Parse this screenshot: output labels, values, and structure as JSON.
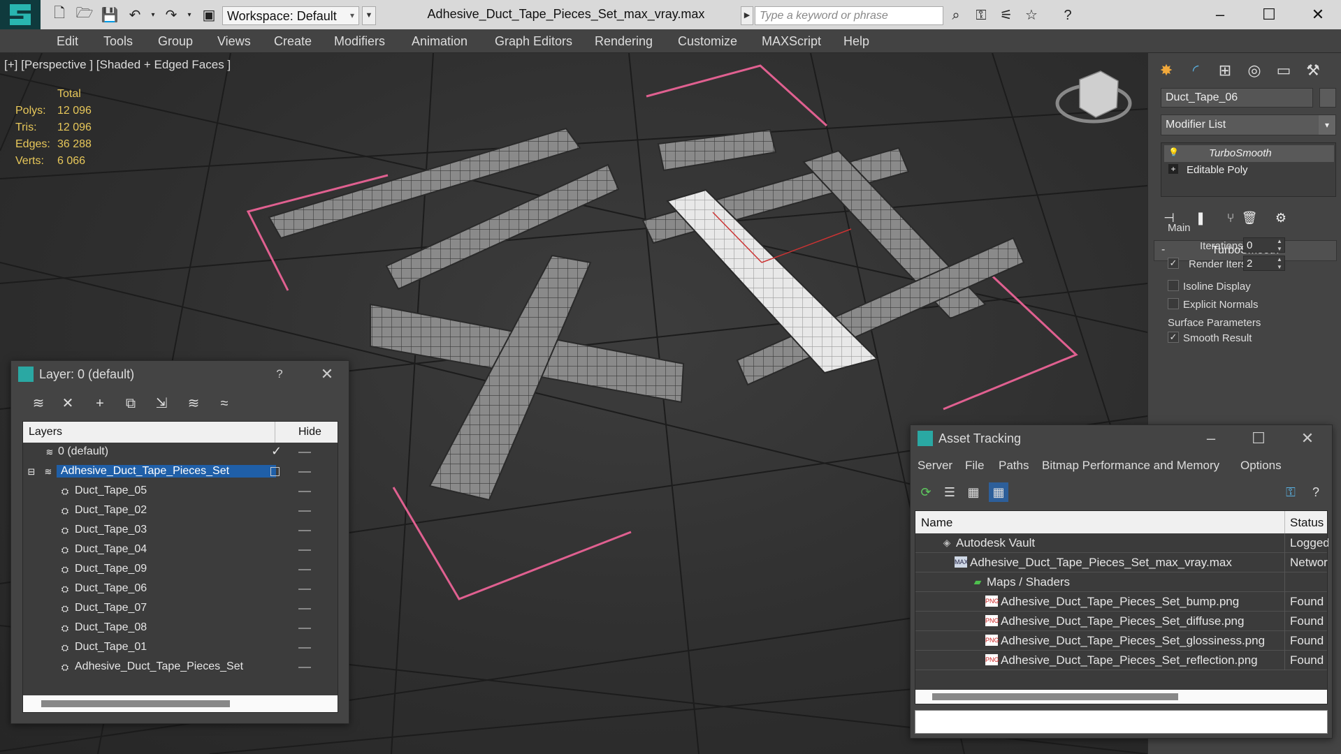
{
  "app": {
    "document_title": "Adhesive_Duct_Tape_Pieces_Set_max_vray.max",
    "workspace_label": "Workspace: Default",
    "search_placeholder": "Type a keyword or phrase"
  },
  "menu": [
    "Edit",
    "Tools",
    "Group",
    "Views",
    "Create",
    "Modifiers",
    "Animation",
    "Graph Editors",
    "Rendering",
    "Customize",
    "MAXScript",
    "Help"
  ],
  "viewport": {
    "label": "[+] [Perspective ] [Shaded + Edged Faces ]",
    "stats": {
      "header": "Total",
      "polys_label": "Polys:",
      "polys": "12 096",
      "tris_label": "Tris:",
      "tris": "12 096",
      "edges_label": "Edges:",
      "edges": "36 288",
      "verts_label": "Verts:",
      "verts": "6 066"
    }
  },
  "command_panel": {
    "object_name": "Duct_Tape_06",
    "modifier_list": "Modifier List",
    "stack": [
      "TurboSmooth",
      "Editable Poly"
    ],
    "rollout_title": "TurboSmooth",
    "main_group": "Main",
    "iterations_label": "Iterations:",
    "iterations": "0",
    "render_iters_label": "Render Iters:",
    "render_iters": "2",
    "isoline_label": "Isoline Display",
    "explicit_normals_label": "Explicit Normals",
    "surface_group": "Surface Parameters",
    "smooth_result_label": "Smooth Result"
  },
  "layer_window": {
    "title": "Layer: 0 (default)",
    "help": "?",
    "col_layers": "Layers",
    "col_hide": "Hide",
    "layers": [
      {
        "name": "0 (default)"
      },
      {
        "name": "Adhesive_Duct_Tape_Pieces_Set"
      },
      {
        "name": "Duct_Tape_05"
      },
      {
        "name": "Duct_Tape_02"
      },
      {
        "name": "Duct_Tape_03"
      },
      {
        "name": "Duct_Tape_04"
      },
      {
        "name": "Duct_Tape_09"
      },
      {
        "name": "Duct_Tape_06"
      },
      {
        "name": "Duct_Tape_07"
      },
      {
        "name": "Duct_Tape_08"
      },
      {
        "name": "Duct_Tape_01"
      },
      {
        "name": "Adhesive_Duct_Tape_Pieces_Set"
      }
    ]
  },
  "asset_window": {
    "title": "Asset Tracking",
    "menu": [
      "Server",
      "File",
      "Paths",
      "Bitmap Performance and Memory",
      "Options"
    ],
    "col_name": "Name",
    "col_status": "Status",
    "rows": [
      {
        "name": "Autodesk Vault",
        "status": "Logged C"
      },
      {
        "name": "Adhesive_Duct_Tape_Pieces_Set_max_vray.max",
        "status": "Network"
      },
      {
        "name": "Maps / Shaders",
        "status": ""
      },
      {
        "name": "Adhesive_Duct_Tape_Pieces_Set_bump.png",
        "status": "Found"
      },
      {
        "name": "Adhesive_Duct_Tape_Pieces_Set_diffuse.png",
        "status": "Found"
      },
      {
        "name": "Adhesive_Duct_Tape_Pieces_Set_glossiness.png",
        "status": "Found"
      },
      {
        "name": "Adhesive_Duct_Tape_Pieces_Set_reflection.png",
        "status": "Found"
      }
    ]
  },
  "colors": {
    "accent": "#29b6b0",
    "selection": "#1f5fa8",
    "stats_text": "#e8c85a",
    "bracket_pink": "#e06090"
  }
}
